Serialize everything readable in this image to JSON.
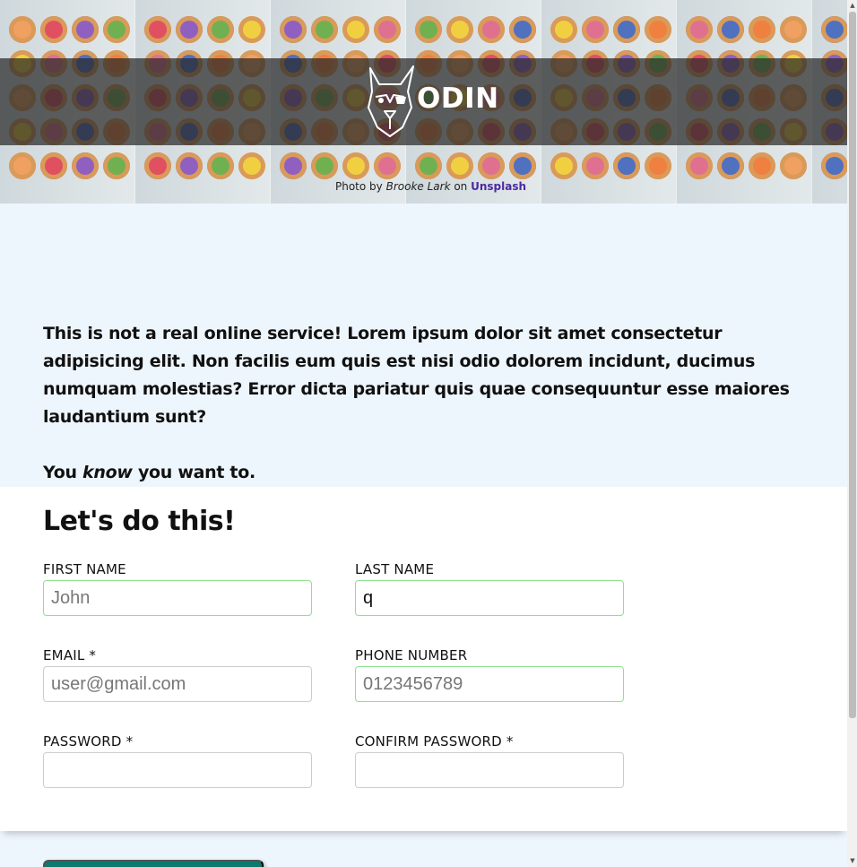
{
  "hero": {
    "logo_text": "ODIN",
    "credit": {
      "prefix": "Photo by",
      "author": "Brooke Lark",
      "on": "on",
      "site": "Unsplash"
    }
  },
  "intro": {
    "paragraph": "This is not a real online service! Lorem ipsum dolor sit amet consectetur adipisicing elit. Non facilis eum quis est nisi odio dolorem incidunt, ducimus numquam molestias? Error dicta pariatur quis quae consequuntur esse maiores laudantium sunt?",
    "line_prefix": "You",
    "line_emphasis": "know",
    "line_suffix": "you want to."
  },
  "form": {
    "title": "Let's do this!",
    "first_name": {
      "label": "FIRST NAME",
      "placeholder": "John",
      "value": ""
    },
    "last_name": {
      "label": "LAST NAME",
      "placeholder": "",
      "value": "q"
    },
    "email": {
      "label": "EMAIL *",
      "placeholder": "user@gmail.com",
      "value": ""
    },
    "phone": {
      "label": "PHONE NUMBER",
      "placeholder": "0123456789",
      "value": ""
    },
    "password": {
      "label": "PASSWORD *",
      "placeholder": "",
      "value": ""
    },
    "confirm_password": {
      "label": "CONFIRM PASSWORD *",
      "placeholder": "",
      "value": ""
    }
  },
  "colors": {
    "page_bg": "#eef6fd",
    "valid_border": "#8fe08f",
    "button": "#0c7a6e",
    "link": "#4b2aa0"
  },
  "icons": {
    "logo": "odin-dog-head-icon",
    "scroll_up": "triangle-up-icon",
    "scroll_down": "triangle-down-icon"
  }
}
